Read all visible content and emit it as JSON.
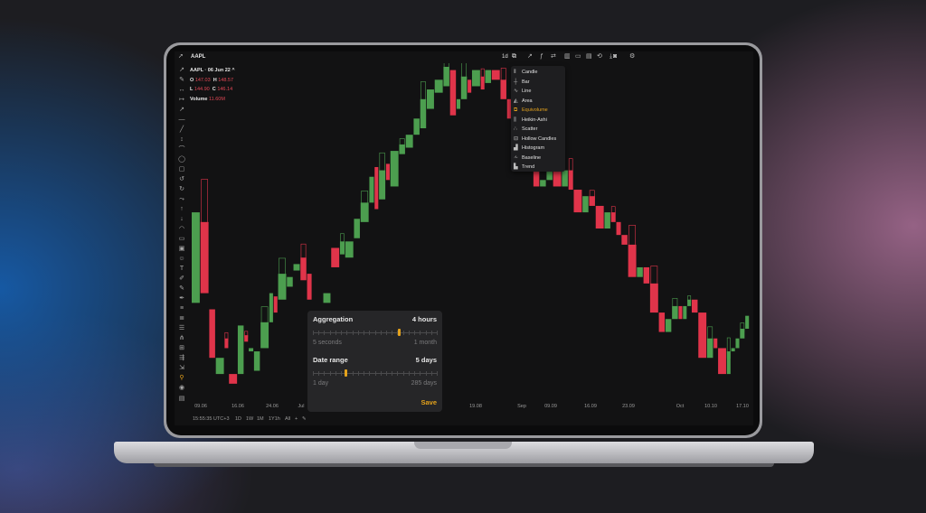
{
  "colors": {
    "up": "#4c9e4f",
    "down": "#e0344a",
    "accent": "#e4a21c"
  },
  "header": {
    "symbol": "AAPL",
    "interval": "1d"
  },
  "legend": {
    "title": "AAPL · 06 Jun 22 ^",
    "open_label": "O",
    "open": "147.03",
    "high_label": "H",
    "high": "148.57",
    "low_label": "L",
    "low": "144.90",
    "close_label": "C",
    "close": "146.14",
    "volume_label": "Volume",
    "volume": "11.60M"
  },
  "chart_type_menu": {
    "items": [
      {
        "label": "Candle",
        "icon": "candle-icon"
      },
      {
        "label": "Bar",
        "icon": "bar-icon"
      },
      {
        "label": "Line",
        "icon": "line-icon"
      },
      {
        "label": "Area",
        "icon": "area-icon"
      },
      {
        "label": "Equivolume",
        "icon": "equivolume-icon",
        "selected": true
      },
      {
        "label": "Heikin-Ashi",
        "icon": "heikin-ashi-icon"
      },
      {
        "label": "Scatter",
        "icon": "scatter-icon"
      },
      {
        "label": "Hollow Candles",
        "icon": "hollow-candles-icon"
      },
      {
        "label": "Histogram",
        "icon": "histogram-icon"
      },
      {
        "label": "Baseline",
        "icon": "baseline-icon"
      },
      {
        "label": "Trend",
        "icon": "trend-icon"
      }
    ]
  },
  "settings": {
    "aggregation_label": "Aggregation",
    "aggregation_value": "4 hours",
    "aggregation_min": "5 seconds",
    "aggregation_max": "1 month",
    "aggregation_level": 0.7,
    "date_range_label": "Date range",
    "date_range_value": "5 days",
    "date_range_min": "1 day",
    "date_range_max": "285 days",
    "date_range_level": 0.27,
    "save_label": "Save"
  },
  "x_axis_labels": [
    "09.06",
    "16.06",
    "24.06",
    "Jul",
    "19.08",
    "Sep",
    "09.09",
    "16.09",
    "23.09",
    "Oct",
    "10.10",
    "17.10"
  ],
  "bottom_bar": {
    "time": "15:55:35 UTC+3",
    "ranges": [
      "1D",
      "1W",
      "1M",
      "1Y1h",
      "All"
    ]
  },
  "chart_data": {
    "type": "candlestick",
    "candles": [
      {
        "o": 0.27,
        "c": 0.55,
        "v": 2
      },
      {
        "o": 0.52,
        "c": 0.3,
        "v": 2
      },
      {
        "o": 0.25,
        "c": 0.1,
        "v": 1.5
      },
      {
        "o": 0.05,
        "c": 0.1,
        "v": 2
      },
      {
        "o": 0.16,
        "c": 0.13,
        "v": 1
      },
      {
        "o": 0.05,
        "c": 0.02,
        "v": 2
      },
      {
        "o": 0.05,
        "c": 0.2,
        "v": 1.5
      },
      {
        "o": 0.17,
        "c": 0.15,
        "v": 1
      },
      {
        "o": 0.12,
        "c": 0.13,
        "v": 1.2
      },
      {
        "o": 0.06,
        "c": 0.12,
        "v": 1.5
      },
      {
        "o": 0.13,
        "c": 0.21,
        "v": 2
      },
      {
        "o": 0.21,
        "c": 0.3,
        "v": 1
      },
      {
        "o": 0.29,
        "c": 0.24,
        "v": 1
      },
      {
        "o": 0.28,
        "c": 0.36,
        "v": 2
      },
      {
        "o": 0.32,
        "c": 0.35,
        "v": 1.5
      },
      {
        "o": 0.37,
        "c": 0.39,
        "v": 1.6
      },
      {
        "o": 0.41,
        "c": 0.34,
        "v": 1.5
      },
      {
        "o": 0.36,
        "c": 0.28,
        "v": 1.2
      },
      {
        "o": 0.22,
        "c": 0.12,
        "v": 1
      },
      {
        "o": 0.18,
        "c": 0.22,
        "v": 1.5
      },
      {
        "o": 0.27,
        "c": 0.3,
        "v": 1.8
      },
      {
        "o": 0.44,
        "c": 0.38,
        "v": 2
      },
      {
        "o": 0.42,
        "c": 0.46,
        "v": 1.2
      },
      {
        "o": 0.41,
        "c": 0.46,
        "v": 2
      },
      {
        "o": 0.47,
        "c": 0.53,
        "v": 1.5
      },
      {
        "o": 0.52,
        "c": 0.58,
        "v": 2
      },
      {
        "o": 0.58,
        "c": 0.66,
        "v": 1.2
      },
      {
        "o": 0.69,
        "c": 0.56,
        "v": 1
      },
      {
        "o": 0.59,
        "c": 0.68,
        "v": 1.6
      },
      {
        "o": 0.7,
        "c": 0.65,
        "v": 1
      },
      {
        "o": 0.63,
        "c": 0.74,
        "v": 2
      },
      {
        "o": 0.73,
        "c": 0.76,
        "v": 1.5
      },
      {
        "o": 0.75,
        "c": 0.79,
        "v": 1.8
      },
      {
        "o": 0.79,
        "c": 0.84,
        "v": 1.5
      },
      {
        "o": 0.81,
        "c": 0.9,
        "v": 1.5
      },
      {
        "o": 0.87,
        "c": 0.93,
        "v": 1.8
      },
      {
        "o": 0.92,
        "c": 0.96,
        "v": 2
      },
      {
        "o": 0.94,
        "c": 1.0,
        "v": 1.5
      },
      {
        "o": 0.99,
        "c": 0.85,
        "v": 1.5
      },
      {
        "o": 0.87,
        "c": 0.9,
        "v": 1
      },
      {
        "o": 0.9,
        "c": 0.97,
        "v": 1.5
      },
      {
        "o": 0.96,
        "c": 0.92,
        "v": 1
      },
      {
        "o": 0.94,
        "c": 0.99,
        "v": 2
      },
      {
        "o": 0.97,
        "c": 0.93,
        "v": 1
      },
      {
        "o": 0.95,
        "c": 0.99,
        "v": 1.5
      },
      {
        "o": 0.99,
        "c": 0.96,
        "v": 2
      },
      {
        "o": 0.96,
        "c": 0.9,
        "v": 1.5
      },
      {
        "o": 0.9,
        "c": 0.84,
        "v": 2
      },
      {
        "o": 0.84,
        "c": 0.77,
        "v": 2
      },
      {
        "o": 0.77,
        "c": 0.69,
        "v": 2
      },
      {
        "o": 0.69,
        "c": 0.63,
        "v": 1.5
      },
      {
        "o": 0.63,
        "c": 0.65,
        "v": 1.5
      },
      {
        "o": 0.65,
        "c": 0.69,
        "v": 1.5
      },
      {
        "o": 0.69,
        "c": 0.63,
        "v": 2
      },
      {
        "o": 0.63,
        "c": 0.68,
        "v": 1.5
      },
      {
        "o": 0.68,
        "c": 0.62,
        "v": 1.2
      },
      {
        "o": 0.62,
        "c": 0.55,
        "v": 2
      },
      {
        "o": 0.55,
        "c": 0.6,
        "v": 1.5
      },
      {
        "o": 0.6,
        "c": 0.57,
        "v": 1.5
      },
      {
        "o": 0.57,
        "c": 0.5,
        "v": 2
      },
      {
        "o": 0.5,
        "c": 0.55,
        "v": 1.5
      },
      {
        "o": 0.55,
        "c": 0.52,
        "v": 1.2
      },
      {
        "o": 0.52,
        "c": 0.48,
        "v": 1.2
      },
      {
        "o": 0.48,
        "c": 0.45,
        "v": 1.5
      },
      {
        "o": 0.45,
        "c": 0.35,
        "v": 2
      },
      {
        "o": 0.35,
        "c": 0.38,
        "v": 1.5
      },
      {
        "o": 0.38,
        "c": 0.33,
        "v": 1.5
      },
      {
        "o": 0.33,
        "c": 0.24,
        "v": 2
      },
      {
        "o": 0.24,
        "c": 0.18,
        "v": 1.5
      },
      {
        "o": 0.18,
        "c": 0.22,
        "v": 1.5
      },
      {
        "o": 0.22,
        "c": 0.26,
        "v": 1.5
      },
      {
        "o": 0.26,
        "c": 0.22,
        "v": 1
      },
      {
        "o": 0.22,
        "c": 0.26,
        "v": 1
      },
      {
        "o": 0.26,
        "c": 0.28,
        "v": 1
      },
      {
        "o": 0.28,
        "c": 0.24,
        "v": 1.5
      },
      {
        "o": 0.24,
        "c": 0.1,
        "v": 2
      },
      {
        "o": 0.1,
        "c": 0.16,
        "v": 1.5
      },
      {
        "o": 0.16,
        "c": 0.13,
        "v": 1
      },
      {
        "o": 0.13,
        "c": 0.05,
        "v": 2
      },
      {
        "o": 0.05,
        "c": 0.12,
        "v": 1
      },
      {
        "o": 0.12,
        "c": 0.13,
        "v": 1
      },
      {
        "o": 0.13,
        "c": 0.16,
        "v": 1
      },
      {
        "o": 0.16,
        "c": 0.19,
        "v": 1.2
      },
      {
        "o": 0.19,
        "c": 0.23,
        "v": 1
      }
    ]
  }
}
